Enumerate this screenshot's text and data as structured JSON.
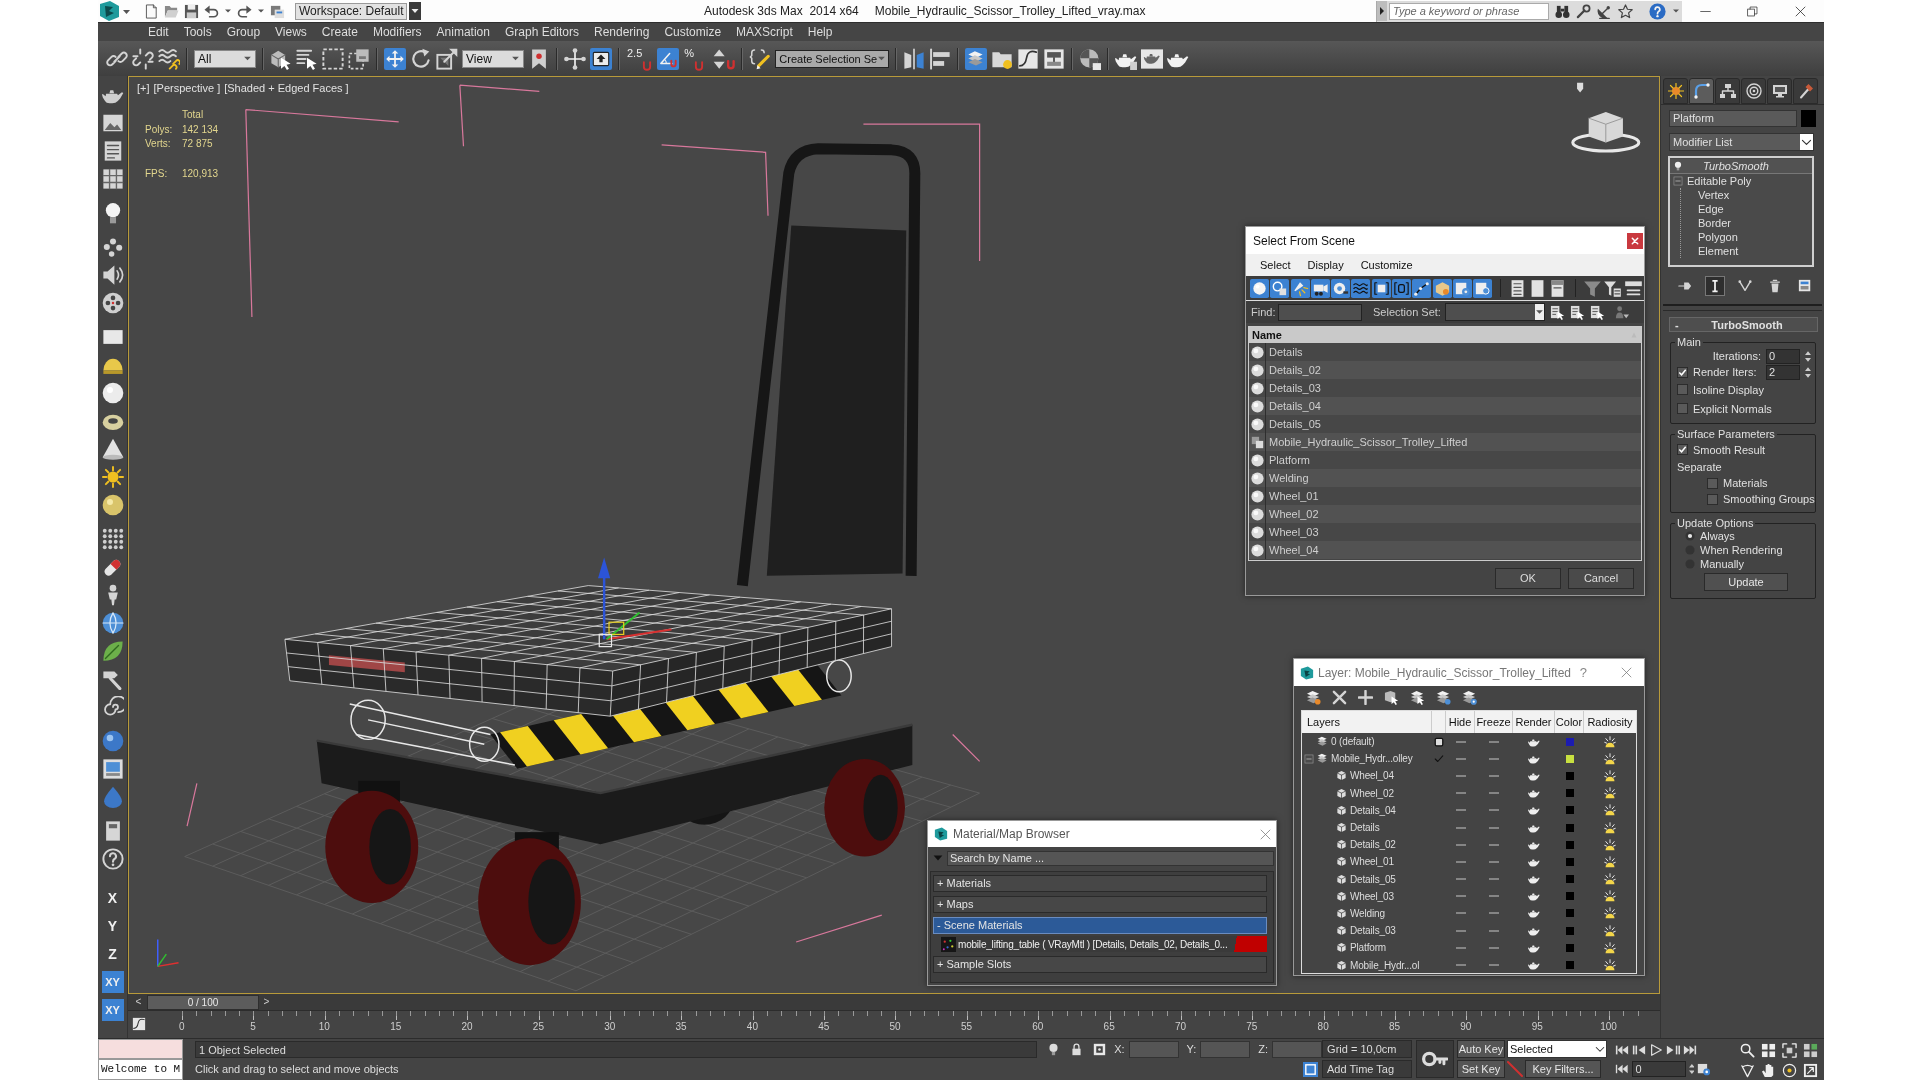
{
  "title_bar": {
    "workspace": "Workspace: Default",
    "app_title": "Autodesk 3ds Max  2014 x64",
    "file_name": "Mobile_Hydraulic_Scissor_Trolley_Lifted_vray.max",
    "search": {
      "placeholder": "Type a keyword or phrase"
    }
  },
  "menu": [
    "Edit",
    "Tools",
    "Group",
    "Views",
    "Create",
    "Modifiers",
    "Animation",
    "Graph Editors",
    "Rendering",
    "Customize",
    "MAXScript",
    "Help"
  ],
  "main_toolbar": [
    [
      {
        "kind": "link",
        "on": false
      },
      {
        "kind": "unlink",
        "on": false
      },
      {
        "kind": "bind",
        "on": false
      }
    ],
    [
      {
        "kind": "dropdown",
        "value": "All",
        "on": false
      }
    ],
    [
      {
        "kind": "select",
        "on": false
      },
      {
        "kind": "select_by_name",
        "on": false
      },
      {
        "kind": "rect_region",
        "on": false
      },
      {
        "kind": "window_crossing",
        "on": false
      }
    ],
    [
      {
        "kind": "move",
        "on": true
      },
      {
        "kind": "rotate",
        "on": false
      },
      {
        "kind": "scale",
        "on": false
      },
      {
        "kind": "dropdown",
        "value": "View",
        "on": false
      },
      {
        "kind": "pivot",
        "on": false
      }
    ],
    [
      {
        "kind": "manipulate",
        "on": false
      },
      {
        "kind": "kbd_override",
        "on": true
      }
    ],
    [
      {
        "kind": "snap",
        "label": "2.5",
        "on": false
      },
      {
        "kind": "angle_snap",
        "on": true
      },
      {
        "kind": "percent_snap",
        "label": "%",
        "on": false
      },
      {
        "kind": "spinner_snap",
        "on": false
      }
    ],
    [
      {
        "kind": "edit_named",
        "on": false
      },
      {
        "kind": "combo",
        "value": "Create Selection Se",
        "on": false
      }
    ],
    [
      {
        "kind": "mirror",
        "on": false
      },
      {
        "kind": "align",
        "on": false
      }
    ],
    [
      {
        "kind": "layers",
        "on": true
      },
      {
        "kind": "explorer",
        "on": false
      },
      {
        "kind": "curve",
        "on": false
      },
      {
        "kind": "schematic",
        "on": false
      }
    ],
    [
      {
        "kind": "material",
        "on": false
      }
    ],
    [
      {
        "kind": "render_setup",
        "on": false
      },
      {
        "kind": "frame_window",
        "on": false
      },
      {
        "kind": "render",
        "on": false
      }
    ]
  ],
  "left_toolbar": {
    "axes": [
      {
        "label": "X",
        "selected": false
      },
      {
        "label": "Y",
        "selected": false
      },
      {
        "label": "Z",
        "selected": false
      },
      {
        "label": "XY",
        "selected": true
      },
      {
        "label": "XY",
        "selected": true
      }
    ]
  },
  "viewport": {
    "labels": [
      "[+]",
      "[Perspective ]",
      "[Shaded + Edged Faces ]"
    ],
    "stats": {
      "heading": "Total",
      "rows": [
        {
          "label": "Polys:",
          "value": "142 134"
        },
        {
          "label": "Verts:",
          "value": "72 875"
        }
      ],
      "fps": {
        "label": "FPS:",
        "value": "120,913"
      }
    }
  },
  "timeline": {
    "slider": {
      "prev": "<",
      "label": "0 / 100",
      "next": ">",
      "level": 0
    },
    "ticks": [
      "0",
      "5",
      "10",
      "15",
      "20",
      "25",
      "30",
      "35",
      "40",
      "45",
      "50",
      "55",
      "60",
      "65",
      "70",
      "75",
      "80",
      "85",
      "90",
      "95",
      "100"
    ]
  },
  "command_panel": {
    "tabs": [
      {
        "kind": "create",
        "selected": false
      },
      {
        "kind": "modify",
        "selected": true
      },
      {
        "kind": "hierarchy",
        "selected": false
      },
      {
        "kind": "motion",
        "selected": false
      },
      {
        "kind": "display",
        "selected": false
      },
      {
        "kind": "utilities",
        "selected": false
      }
    ],
    "object_name": "Platform",
    "modifier_list": "Modifier List",
    "stack": [
      {
        "kind": "modifier",
        "label": "TurboSmooth",
        "selected": true
      },
      {
        "kind": "base",
        "label": "Editable Poly",
        "selected": false,
        "expanded": true,
        "children": [
          {
            "label": "Vertex",
            "selected": false
          },
          {
            "label": "Edge",
            "selected": false
          },
          {
            "label": "Border",
            "selected": false
          },
          {
            "label": "Polygon",
            "selected": false
          },
          {
            "label": "Element",
            "selected": false
          }
        ]
      }
    ],
    "stack_tools": [
      {
        "kind": "pin",
        "on": false
      },
      {
        "kind": "show_end",
        "on": true
      },
      {
        "kind": "unique",
        "on": false
      },
      {
        "kind": "remove",
        "on": false
      },
      {
        "kind": "configure",
        "on": false
      }
    ],
    "rollout": {
      "toggle": "-",
      "title": "TurboSmooth",
      "groups": [
        {
          "title": "Main",
          "controls": [
            {
              "kind": "spinner",
              "label": "Iterations:",
              "value": "0"
            },
            {
              "kind": "check_spinner",
              "label": "Render Iters:",
              "checked": true,
              "value": "2"
            },
            {
              "kind": "checkbox",
              "label": "Isoline Display",
              "checked": false
            },
            {
              "kind": "checkbox",
              "label": "Explicit Normals",
              "checked": false
            }
          ]
        },
        {
          "title": "Surface Parameters",
          "controls": [
            {
              "kind": "checkbox",
              "label": "Smooth Result",
              "checked": true
            },
            {
              "kind": "label",
              "label": "Separate"
            },
            {
              "kind": "sub_checkbox",
              "label": "Materials",
              "checked": false
            },
            {
              "kind": "sub_checkbox",
              "label": "Smoothing Groups",
              "checked": false
            }
          ]
        },
        {
          "title": "Update Options",
          "controls": [
            {
              "kind": "radio",
              "label": "Always",
              "selected": true
            },
            {
              "kind": "radio",
              "label": "When Rendering",
              "selected": false
            },
            {
              "kind": "radio",
              "label": "Manually",
              "selected": false
            },
            {
              "kind": "button",
              "label": "Update"
            }
          ]
        }
      ]
    }
  },
  "status_bar": {
    "listener": "Welcome to M",
    "selection": "1 Object Selected",
    "prompt": "Click and drag to select and move objects",
    "coords": [
      "X:",
      "Y:",
      "Z:"
    ],
    "grid": "Grid = 10,0cm",
    "time_tag": "Add Time Tag",
    "auto_key": "Auto Key",
    "key_mode": "Selected",
    "set_key": "Set Key",
    "key_filters": "Key Filters...",
    "frame": "0"
  },
  "select_from_scene": {
    "title": "Select From Scene",
    "menu": [
      "Select",
      "Display",
      "Customize"
    ],
    "filters": [
      {
        "kind": "geometry",
        "on": true
      },
      {
        "kind": "shape",
        "on": true
      },
      {
        "kind": "light",
        "on": true
      },
      {
        "kind": "camera",
        "on": true
      },
      {
        "kind": "helper",
        "on": true
      },
      {
        "kind": "spacewarp",
        "on": true
      },
      {
        "kind": "group",
        "on": true
      },
      {
        "kind": "xref",
        "on": true
      },
      {
        "kind": "bone",
        "on": true
      },
      {
        "kind": "container",
        "on": true
      },
      {
        "kind": "frozen",
        "on": true
      },
      {
        "kind": "hidden",
        "on": true
      }
    ],
    "find_label": "Find:",
    "selection_set_label": "Selection Set:",
    "column": "Name",
    "rows": [
      {
        "name": "Details",
        "kind": "object",
        "selected": false
      },
      {
        "name": "Details_02",
        "kind": "object",
        "selected": false
      },
      {
        "name": "Details_03",
        "kind": "object",
        "selected": false
      },
      {
        "name": "Details_04",
        "kind": "object",
        "selected": false
      },
      {
        "name": "Details_05",
        "kind": "object",
        "selected": false
      },
      {
        "name": "Mobile_Hydraulic_Scissor_Trolley_Lifted",
        "kind": "group",
        "selected": false
      },
      {
        "name": "Platform",
        "kind": "object",
        "selected": false
      },
      {
        "name": "Welding",
        "kind": "object",
        "selected": false
      },
      {
        "name": "Wheel_01",
        "kind": "object",
        "selected": false
      },
      {
        "name": "Wheel_02",
        "kind": "object",
        "selected": false
      },
      {
        "name": "Wheel_03",
        "kind": "object",
        "selected": false
      },
      {
        "name": "Wheel_04",
        "kind": "object",
        "selected": false
      }
    ],
    "buttons": [
      "OK",
      "Cancel"
    ]
  },
  "layer_dialog": {
    "title": "Layer: Mobile_Hydraulic_Scissor_Trolley_Lifted",
    "help": "?",
    "columns": [
      "Layers",
      "Hide",
      "Freeze",
      "Render",
      "Color",
      "Radiosity"
    ],
    "layers": [
      {
        "name": "0 (default)",
        "current": false,
        "hidden": false,
        "frozen": false,
        "render": true,
        "radiosity": true,
        "color": "#1c1cb0"
      },
      {
        "name": "Mobile_Hydr...olley",
        "current": true,
        "expanded": true,
        "hidden": false,
        "frozen": false,
        "render": true,
        "radiosity": true,
        "color": "#c8e040",
        "children": [
          {
            "name": "Wheel_04",
            "hidden": false,
            "frozen": false,
            "render": true,
            "radiosity": true,
            "color": "#000000"
          },
          {
            "name": "Wheel_02",
            "hidden": false,
            "frozen": false,
            "render": true,
            "radiosity": true,
            "color": "#000000"
          },
          {
            "name": "Details_04",
            "hidden": false,
            "frozen": false,
            "render": true,
            "radiosity": true,
            "color": "#000000"
          },
          {
            "name": "Details",
            "hidden": false,
            "frozen": false,
            "render": true,
            "radiosity": true,
            "color": "#000000"
          },
          {
            "name": "Details_02",
            "hidden": false,
            "frozen": false,
            "render": true,
            "radiosity": true,
            "color": "#000000"
          },
          {
            "name": "Wheel_01",
            "hidden": false,
            "frozen": false,
            "render": true,
            "radiosity": true,
            "color": "#000000"
          },
          {
            "name": "Details_05",
            "hidden": false,
            "frozen": false,
            "render": true,
            "radiosity": true,
            "color": "#000000"
          },
          {
            "name": "Wheel_03",
            "hidden": false,
            "frozen": false,
            "render": true,
            "radiosity": true,
            "color": "#000000"
          },
          {
            "name": "Welding",
            "hidden": false,
            "frozen": false,
            "render": true,
            "radiosity": true,
            "color": "#000000"
          },
          {
            "name": "Details_03",
            "hidden": false,
            "frozen": false,
            "render": true,
            "radiosity": true,
            "color": "#000000"
          },
          {
            "name": "Platform",
            "hidden": false,
            "frozen": false,
            "render": true,
            "radiosity": true,
            "color": "#000000"
          },
          {
            "name": "Mobile_Hydr...ol",
            "hidden": false,
            "frozen": false,
            "render": true,
            "radiosity": true,
            "color": "#000000"
          }
        ]
      }
    ]
  },
  "material_browser": {
    "title": "Material/Map Browser",
    "search": {
      "placeholder": "Search by Name ..."
    },
    "sections": [
      {
        "label": "+ Materials",
        "selected": false
      },
      {
        "label": "+ Maps",
        "selected": false
      },
      {
        "label": "- Scene Materials",
        "selected": true,
        "items": [
          "mobile_lifting_table ( VRayMtl ) [Details, Details_02, Details_0..."
        ]
      },
      {
        "label": "+ Sample Slots",
        "selected": false
      }
    ]
  }
}
